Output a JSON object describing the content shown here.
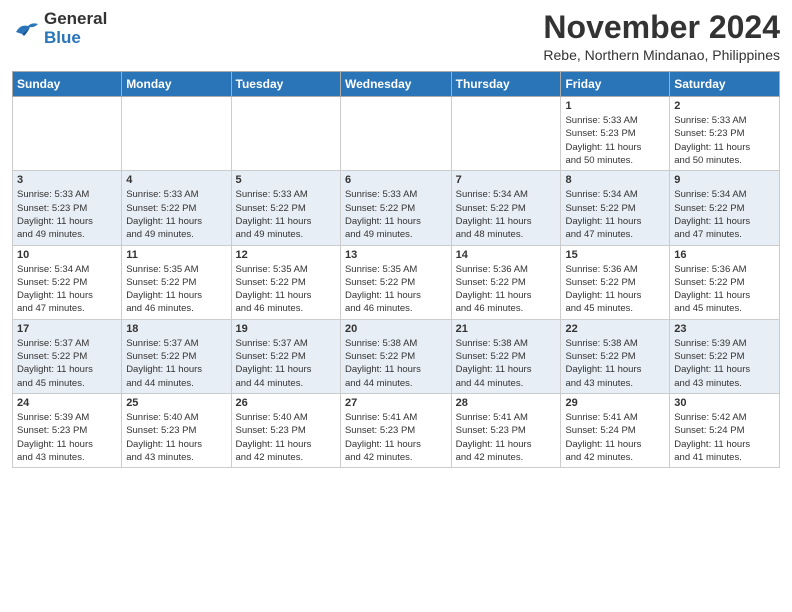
{
  "header": {
    "logo_line1": "General",
    "logo_line2": "Blue",
    "month": "November 2024",
    "location": "Rebe, Northern Mindanao, Philippines"
  },
  "weekdays": [
    "Sunday",
    "Monday",
    "Tuesday",
    "Wednesday",
    "Thursday",
    "Friday",
    "Saturday"
  ],
  "weeks": [
    [
      {
        "day": "",
        "info": ""
      },
      {
        "day": "",
        "info": ""
      },
      {
        "day": "",
        "info": ""
      },
      {
        "day": "",
        "info": ""
      },
      {
        "day": "",
        "info": ""
      },
      {
        "day": "1",
        "info": "Sunrise: 5:33 AM\nSunset: 5:23 PM\nDaylight: 11 hours\nand 50 minutes."
      },
      {
        "day": "2",
        "info": "Sunrise: 5:33 AM\nSunset: 5:23 PM\nDaylight: 11 hours\nand 50 minutes."
      }
    ],
    [
      {
        "day": "3",
        "info": "Sunrise: 5:33 AM\nSunset: 5:23 PM\nDaylight: 11 hours\nand 49 minutes."
      },
      {
        "day": "4",
        "info": "Sunrise: 5:33 AM\nSunset: 5:22 PM\nDaylight: 11 hours\nand 49 minutes."
      },
      {
        "day": "5",
        "info": "Sunrise: 5:33 AM\nSunset: 5:22 PM\nDaylight: 11 hours\nand 49 minutes."
      },
      {
        "day": "6",
        "info": "Sunrise: 5:33 AM\nSunset: 5:22 PM\nDaylight: 11 hours\nand 49 minutes."
      },
      {
        "day": "7",
        "info": "Sunrise: 5:34 AM\nSunset: 5:22 PM\nDaylight: 11 hours\nand 48 minutes."
      },
      {
        "day": "8",
        "info": "Sunrise: 5:34 AM\nSunset: 5:22 PM\nDaylight: 11 hours\nand 47 minutes."
      },
      {
        "day": "9",
        "info": "Sunrise: 5:34 AM\nSunset: 5:22 PM\nDaylight: 11 hours\nand 47 minutes."
      }
    ],
    [
      {
        "day": "10",
        "info": "Sunrise: 5:34 AM\nSunset: 5:22 PM\nDaylight: 11 hours\nand 47 minutes."
      },
      {
        "day": "11",
        "info": "Sunrise: 5:35 AM\nSunset: 5:22 PM\nDaylight: 11 hours\nand 46 minutes."
      },
      {
        "day": "12",
        "info": "Sunrise: 5:35 AM\nSunset: 5:22 PM\nDaylight: 11 hours\nand 46 minutes."
      },
      {
        "day": "13",
        "info": "Sunrise: 5:35 AM\nSunset: 5:22 PM\nDaylight: 11 hours\nand 46 minutes."
      },
      {
        "day": "14",
        "info": "Sunrise: 5:36 AM\nSunset: 5:22 PM\nDaylight: 11 hours\nand 46 minutes."
      },
      {
        "day": "15",
        "info": "Sunrise: 5:36 AM\nSunset: 5:22 PM\nDaylight: 11 hours\nand 45 minutes."
      },
      {
        "day": "16",
        "info": "Sunrise: 5:36 AM\nSunset: 5:22 PM\nDaylight: 11 hours\nand 45 minutes."
      }
    ],
    [
      {
        "day": "17",
        "info": "Sunrise: 5:37 AM\nSunset: 5:22 PM\nDaylight: 11 hours\nand 45 minutes."
      },
      {
        "day": "18",
        "info": "Sunrise: 5:37 AM\nSunset: 5:22 PM\nDaylight: 11 hours\nand 44 minutes."
      },
      {
        "day": "19",
        "info": "Sunrise: 5:37 AM\nSunset: 5:22 PM\nDaylight: 11 hours\nand 44 minutes."
      },
      {
        "day": "20",
        "info": "Sunrise: 5:38 AM\nSunset: 5:22 PM\nDaylight: 11 hours\nand 44 minutes."
      },
      {
        "day": "21",
        "info": "Sunrise: 5:38 AM\nSunset: 5:22 PM\nDaylight: 11 hours\nand 44 minutes."
      },
      {
        "day": "22",
        "info": "Sunrise: 5:38 AM\nSunset: 5:22 PM\nDaylight: 11 hours\nand 43 minutes."
      },
      {
        "day": "23",
        "info": "Sunrise: 5:39 AM\nSunset: 5:22 PM\nDaylight: 11 hours\nand 43 minutes."
      }
    ],
    [
      {
        "day": "24",
        "info": "Sunrise: 5:39 AM\nSunset: 5:23 PM\nDaylight: 11 hours\nand 43 minutes."
      },
      {
        "day": "25",
        "info": "Sunrise: 5:40 AM\nSunset: 5:23 PM\nDaylight: 11 hours\nand 43 minutes."
      },
      {
        "day": "26",
        "info": "Sunrise: 5:40 AM\nSunset: 5:23 PM\nDaylight: 11 hours\nand 42 minutes."
      },
      {
        "day": "27",
        "info": "Sunrise: 5:41 AM\nSunset: 5:23 PM\nDaylight: 11 hours\nand 42 minutes."
      },
      {
        "day": "28",
        "info": "Sunrise: 5:41 AM\nSunset: 5:23 PM\nDaylight: 11 hours\nand 42 minutes."
      },
      {
        "day": "29",
        "info": "Sunrise: 5:41 AM\nSunset: 5:24 PM\nDaylight: 11 hours\nand 42 minutes."
      },
      {
        "day": "30",
        "info": "Sunrise: 5:42 AM\nSunset: 5:24 PM\nDaylight: 11 hours\nand 41 minutes."
      }
    ]
  ]
}
